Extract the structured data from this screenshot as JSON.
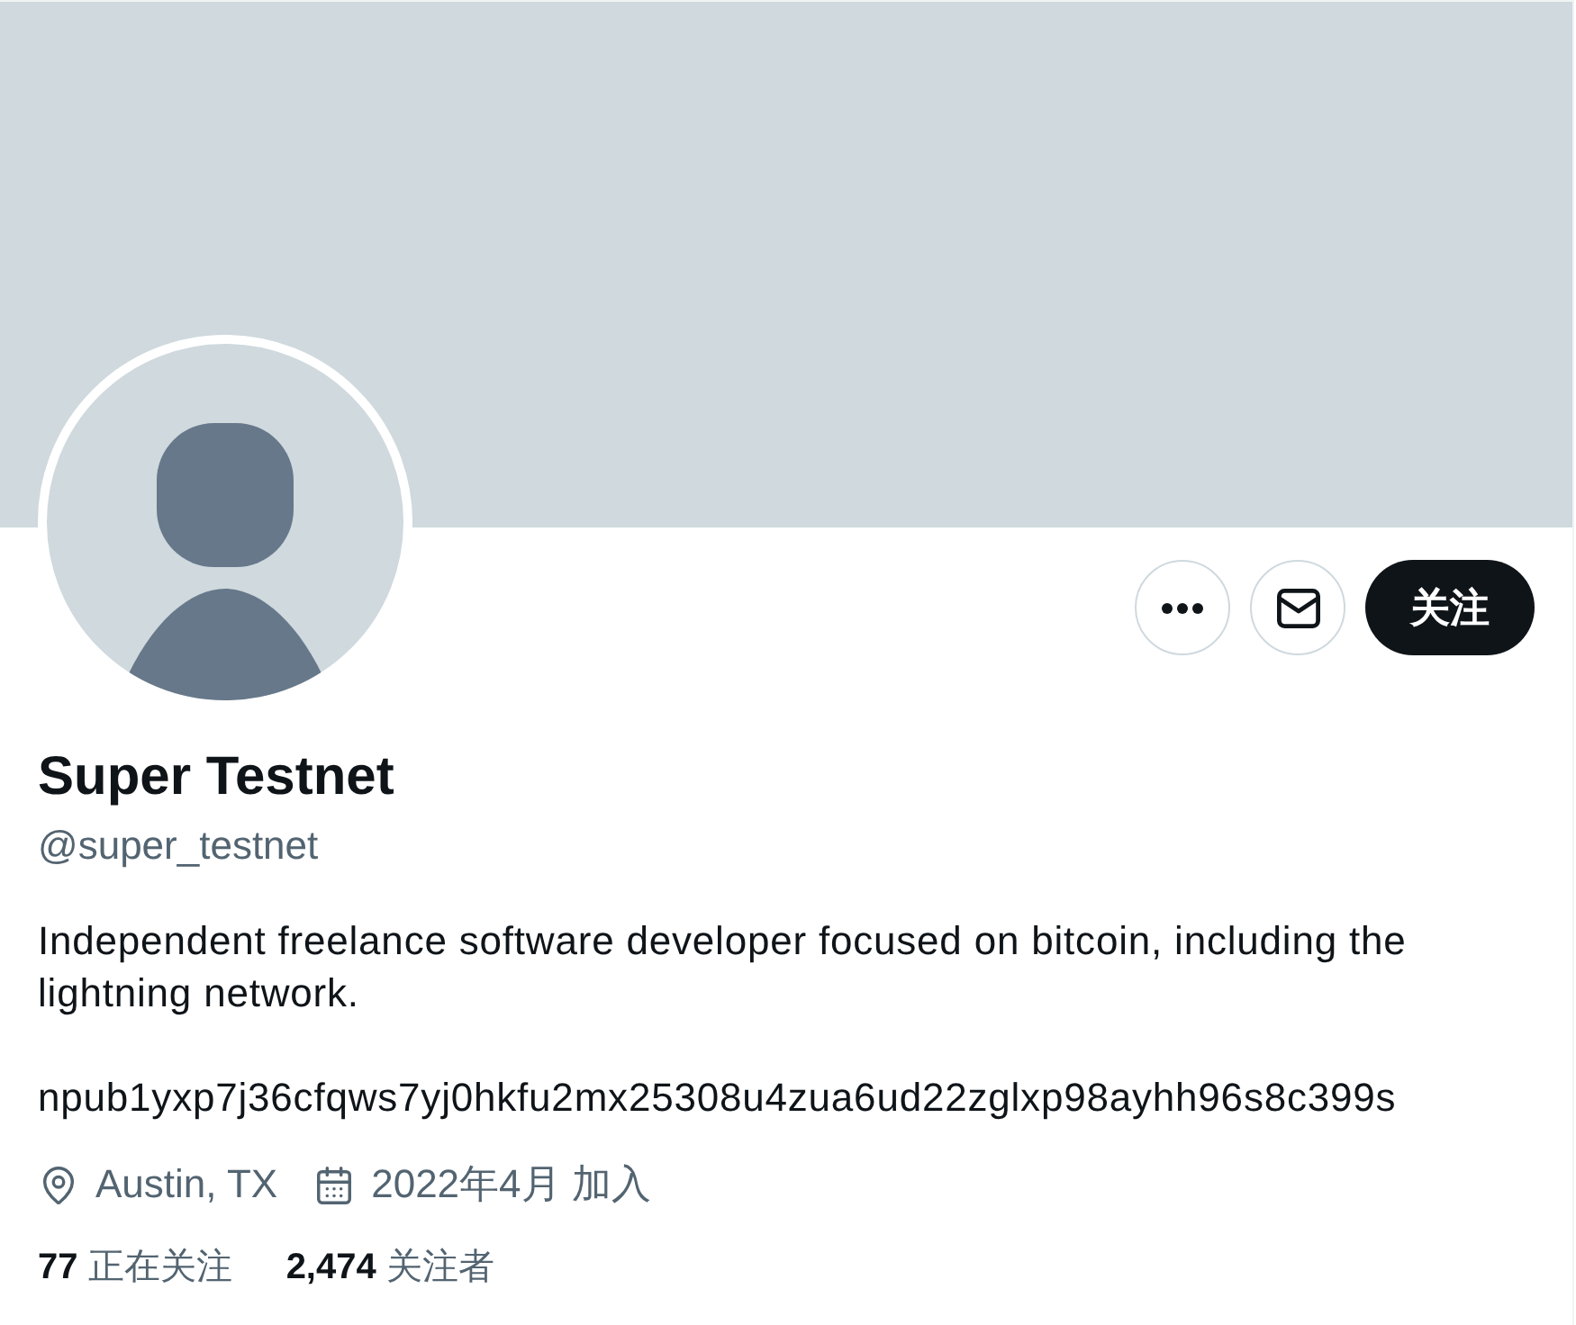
{
  "actions": [
    {
      "kind": "more"
    },
    {
      "kind": "message"
    }
  ],
  "follow_button": {
    "label": "关注"
  },
  "profile": {
    "name": "Super Testnet",
    "handle": "@super_testnet",
    "bio": [
      "Independent freelance software developer focused on bitcoin, including the lightning network.",
      "npub1yxp7j36cfqws7yj0hkfu2mx25308u4zua6ud22zglxp98ayhh96s8c399s"
    ],
    "meta": [
      {
        "kind": "location",
        "text": "Austin, TX"
      },
      {
        "kind": "joined",
        "text": "2022年4月 加入"
      }
    ]
  },
  "stats": [
    {
      "count": "77",
      "label": "正在关注"
    },
    {
      "count": "2,474",
      "label": "关注者"
    }
  ]
}
